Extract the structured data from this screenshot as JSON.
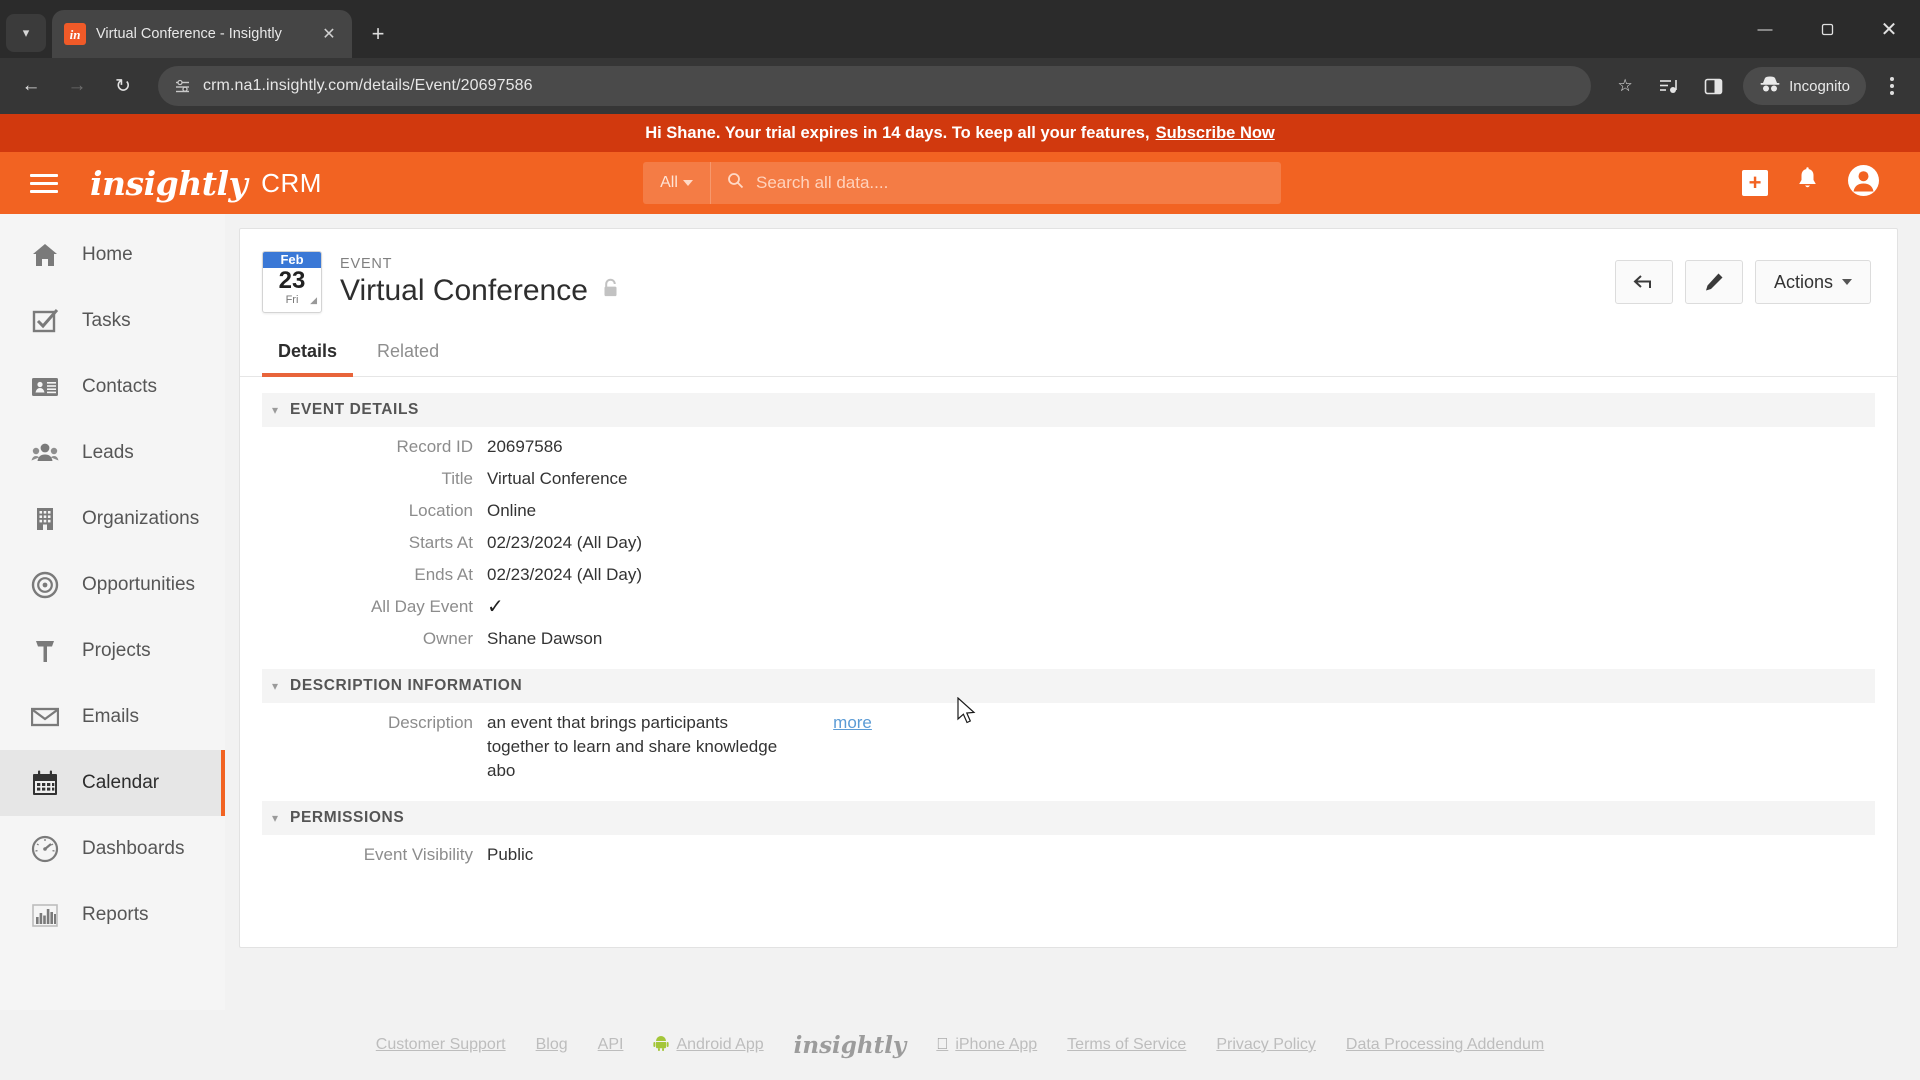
{
  "browser": {
    "tab": {
      "title": "Virtual Conference - Insightly",
      "favicon_icon": "insightly-favicon",
      "close_icon": "close-icon"
    },
    "new_tab_label": "+",
    "tab_list_icon": "chevron-down-icon",
    "window": {
      "minimize": "—",
      "maximize": "❐",
      "close": "✕"
    },
    "nav": {
      "back_icon": "arrow-left-icon",
      "forward_icon": "arrow-right-icon",
      "reload_icon": "reload-icon"
    },
    "address": {
      "site_info_icon": "site-settings-icon",
      "url": "crm.na1.insightly.com/details/Event/20697586"
    },
    "toolbar_icons": {
      "bookmark": "star-icon",
      "media": "media-control-icon",
      "side_panel": "side-panel-icon",
      "menu": "three-dot-menu-icon"
    },
    "incognito_label": "Incognito"
  },
  "banner": {
    "text": "Hi Shane. Your trial expires in 14 days. To keep all your features,",
    "link": "Subscribe Now"
  },
  "appbar": {
    "menu_icon": "hamburger-menu-icon",
    "brand": "insightly",
    "brand_sub": "CRM",
    "search": {
      "scope": "All",
      "placeholder": "Search all data....",
      "value": "",
      "search_icon": "search-icon"
    },
    "add_icon": "plus-icon",
    "notifications_icon": "bell-icon",
    "profile_icon": "user-avatar-icon"
  },
  "sidebar": {
    "items": [
      {
        "label": "Home",
        "icon": "home-icon",
        "active": false
      },
      {
        "label": "Tasks",
        "icon": "task-check-icon",
        "active": false
      },
      {
        "label": "Contacts",
        "icon": "contact-card-icon",
        "active": false
      },
      {
        "label": "Leads",
        "icon": "leads-people-icon",
        "active": false
      },
      {
        "label": "Organizations",
        "icon": "building-icon",
        "active": false
      },
      {
        "label": "Opportunities",
        "icon": "target-icon",
        "active": false
      },
      {
        "label": "Projects",
        "icon": "hammer-icon",
        "active": false
      },
      {
        "label": "Emails",
        "icon": "envelope-icon",
        "active": false
      },
      {
        "label": "Calendar",
        "icon": "calendar-icon",
        "active": true
      },
      {
        "label": "Dashboards",
        "icon": "gauge-icon",
        "active": false
      },
      {
        "label": "Reports",
        "icon": "bar-chart-icon",
        "active": false
      }
    ]
  },
  "record": {
    "date_badge": {
      "month": "Feb",
      "day": "23",
      "weekday": "Fri"
    },
    "eyebrow": "EVENT",
    "title": "Virtual Conference",
    "lock_icon": "lock-icon",
    "actions": {
      "back_icon": "arrow-back-icon",
      "edit_icon": "pencil-edit-icon",
      "actions_label": "Actions",
      "caret_icon": "chevron-down-icon"
    },
    "tabs": [
      {
        "label": "Details",
        "active": true
      },
      {
        "label": "Related",
        "active": false
      }
    ],
    "sections": [
      {
        "title": "EVENT DETAILS",
        "collapse_icon": "chevron-down-icon",
        "fields": [
          {
            "label": "Record ID",
            "value": "20697586"
          },
          {
            "label": "Title",
            "value": "Virtual Conference"
          },
          {
            "label": "Location",
            "value": "Online"
          },
          {
            "label": "Starts At",
            "value": "02/23/2024 (All Day)"
          },
          {
            "label": "Ends At",
            "value": "02/23/2024 (All Day)"
          },
          {
            "label": "All Day Event",
            "value": "✓",
            "is_check": true
          },
          {
            "label": "Owner",
            "value": "Shane Dawson"
          }
        ]
      },
      {
        "title": "DESCRIPTION INFORMATION",
        "collapse_icon": "chevron-down-icon",
        "description": {
          "label": "Description",
          "lines": [
            "an event that brings participants",
            "together to learn and share knowledge",
            "abo"
          ],
          "more_label": "more"
        }
      },
      {
        "title": "PERMISSIONS",
        "collapse_icon": "chevron-down-icon",
        "fields": [
          {
            "label": "Event Visibility",
            "value": "Public"
          }
        ]
      }
    ]
  },
  "footer": {
    "links": [
      "Customer Support",
      "Blog",
      "API"
    ],
    "android_label": "Android App",
    "brand": "insightly",
    "iphone_label": "iPhone App",
    "tail_links": [
      "Terms of Service",
      "Privacy Policy",
      "Data Processing Addendum"
    ]
  },
  "colors": {
    "brand_orange": "#f26322",
    "banner_red": "#d1390e",
    "tab_underline": "#e8643a",
    "badge_blue": "#3a78d6",
    "link_blue": "#5b9bd5"
  }
}
